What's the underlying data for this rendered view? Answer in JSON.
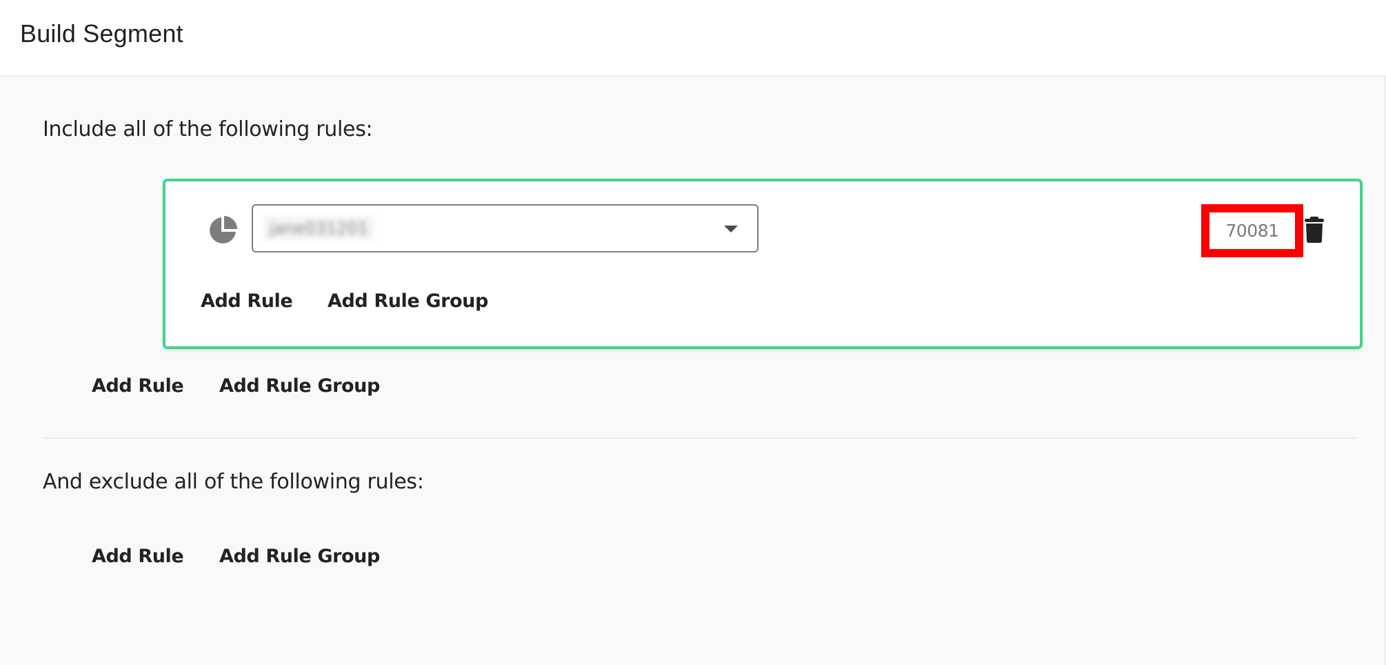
{
  "header": {
    "title": "Build Segment"
  },
  "include": {
    "label": "Include all of the following rules:",
    "rules": [
      {
        "icon": "pie-chart-icon",
        "segment_value": "jane031201",
        "count": "70081",
        "delete_icon": "trash-icon",
        "actions": {
          "add_rule": "Add Rule",
          "add_rule_group": "Add Rule Group"
        }
      }
    ],
    "actions": {
      "add_rule": "Add Rule",
      "add_rule_group": "Add Rule Group"
    }
  },
  "exclude": {
    "label": "And exclude all of the following rules:",
    "actions": {
      "add_rule": "Add Rule",
      "add_rule_group": "Add Rule Group"
    }
  },
  "colors": {
    "card_border": "#3dd68c",
    "highlight_box": "#ff0000",
    "text": "#222222",
    "background": "#f9f9f9"
  }
}
